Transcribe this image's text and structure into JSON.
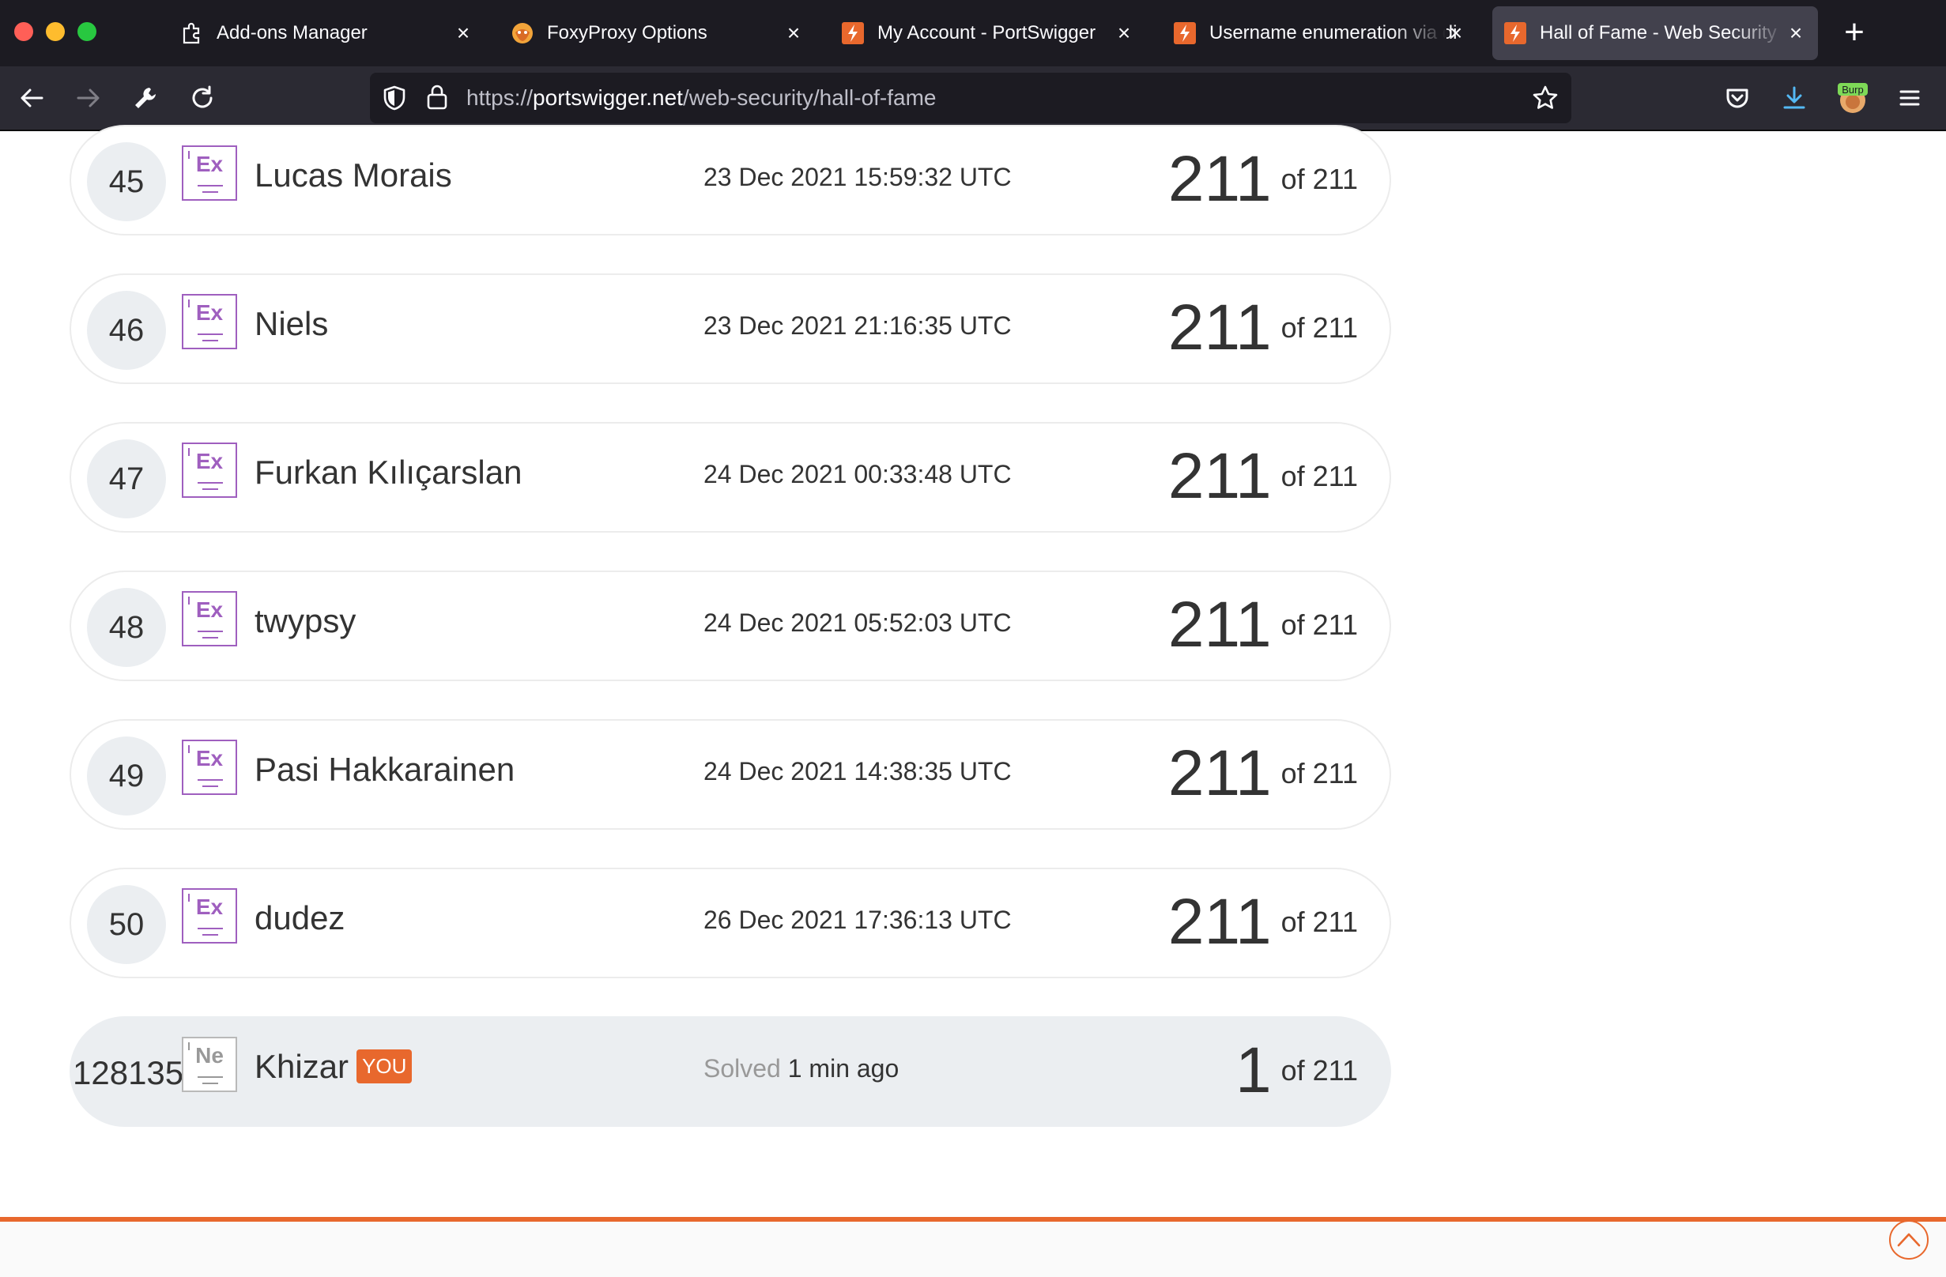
{
  "browser": {
    "tabs": [
      {
        "title": "Add-ons Manager",
        "icon": "puzzle-icon"
      },
      {
        "title": "FoxyProxy Options",
        "icon": "foxyproxy-icon"
      },
      {
        "title": "My Account - PortSwigger",
        "icon": "portswigger-icon"
      },
      {
        "title": "Username enumeration via di",
        "icon": "portswigger-icon"
      },
      {
        "title": "Hall of Fame - Web Security A",
        "icon": "portswigger-icon",
        "active": true
      }
    ],
    "url_prefix": "https://",
    "url_host": "portswigger.net",
    "url_path": "/web-security/hall-of-fame",
    "extension_label": "Burp"
  },
  "leaderboard": {
    "rows": [
      {
        "rank": "45",
        "badge": "Ex",
        "name": "Lucas Morais",
        "time": "23 Dec 2021 15:59:32 UTC",
        "score": "211",
        "total": "of 211"
      },
      {
        "rank": "46",
        "badge": "Ex",
        "name": "Niels",
        "time": "23 Dec 2021 21:16:35 UTC",
        "score": "211",
        "total": "of 211"
      },
      {
        "rank": "47",
        "badge": "Ex",
        "name": "Furkan Kılıçarslan",
        "time": "24 Dec 2021 00:33:48 UTC",
        "score": "211",
        "total": "of 211"
      },
      {
        "rank": "48",
        "badge": "Ex",
        "name": "twypsy",
        "time": "24 Dec 2021 05:52:03 UTC",
        "score": "211",
        "total": "of 211"
      },
      {
        "rank": "49",
        "badge": "Ex",
        "name": "Pasi Hakkarainen",
        "time": "24 Dec 2021 14:38:35 UTC",
        "score": "211",
        "total": "of 211"
      },
      {
        "rank": "50",
        "badge": "Ex",
        "name": "dudez",
        "time": "26 Dec 2021 17:36:13 UTC",
        "score": "211",
        "total": "of 211"
      }
    ],
    "you": {
      "rank": "128135",
      "badge": "Ne",
      "name": "Khizar",
      "you_label": "YOU",
      "solved_label": "Solved",
      "solved_time": "1 min ago",
      "score": "1",
      "total": "of 211"
    }
  },
  "colors": {
    "accent": "#e8682d",
    "badge_expert": "#9f5fbf",
    "row_highlight": "#ebeef1"
  }
}
